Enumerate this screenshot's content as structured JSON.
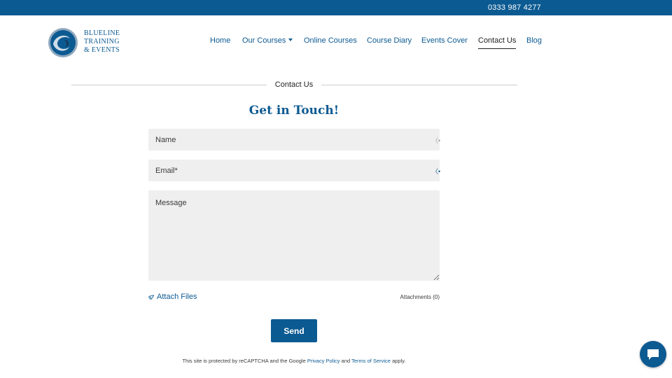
{
  "topbar": {
    "phone": "0333 987 4277"
  },
  "brand": {
    "line1": "BLUELINE",
    "line2": "TRAINING",
    "line3": "& EVENTS",
    "logo_icon": "swirl-logo-icon"
  },
  "nav": {
    "items": [
      {
        "label": "Home"
      },
      {
        "label": "Our Courses"
      },
      {
        "label": "Online Courses"
      },
      {
        "label": "Course Diary"
      },
      {
        "label": "Events Cover"
      },
      {
        "label": "Contact Us",
        "active": true
      },
      {
        "label": "Blog"
      }
    ]
  },
  "section": {
    "title": "Contact Us",
    "heading": "Get in Touch!"
  },
  "form": {
    "name_placeholder": "Name",
    "email_placeholder": "Email*",
    "message_placeholder": "Message",
    "attach_label": "Attach Files",
    "attachments_label": "Attachments (0)",
    "send_label": "Send"
  },
  "legal": {
    "prefix": "This site is protected by reCAPTCHA and the Google",
    "privacy": "Privacy Policy",
    "and": "and",
    "terms": "Terms of Service",
    "suffix": "apply."
  },
  "colors": {
    "brand": "#0c5a92",
    "field_bg": "#efefef"
  },
  "chat": {
    "icon": "chat-bubble-icon"
  }
}
